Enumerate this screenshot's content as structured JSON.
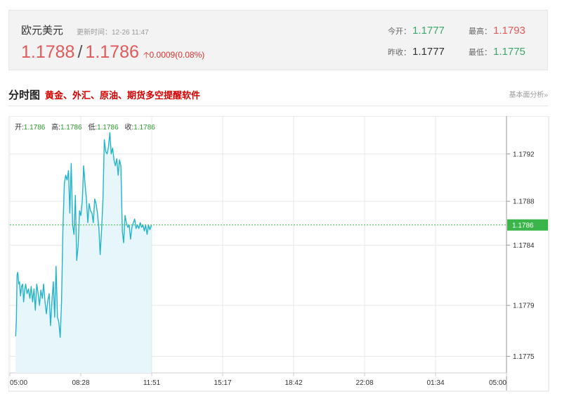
{
  "quote": {
    "pair_name": "欧元美元",
    "update_time": "更新时间：12-26 11:47",
    "bid": "1.1788",
    "ask": "1.1786",
    "change": "0.0009(0.08%)",
    "stats": {
      "open_label": "今开：",
      "open_value": "1.1777",
      "high_label": "最高：",
      "high_value": "1.1793",
      "prev_close_label": "昨收：",
      "prev_close_value": "1.1777",
      "low_label": "最低：",
      "low_value": "1.1775"
    }
  },
  "section": {
    "title": "分时图",
    "promo": "黄金、外汇、原油、期货多空提醒软件",
    "fundamental_link": "基本面分析»"
  },
  "ohlc": {
    "open_label": "开:",
    "open_value": "1.1786",
    "high_label": "高:",
    "high_value": "1.1786",
    "low_label": "低:",
    "low_value": "1.1786",
    "close_label": "收:",
    "close_value": "1.1786"
  },
  "colors": {
    "line": "#23b4cc",
    "area": "#e6f6fa",
    "reference": "#3ab54a",
    "up": "#e05a5a",
    "down": "#3aa86b"
  },
  "chart_data": {
    "type": "line",
    "x_tick_labels": [
      "05:00",
      "08:28",
      "11:51",
      "15:17",
      "18:42",
      "22:08",
      "01:34",
      "05:00"
    ],
    "y_tick_labels": [
      "1.1792",
      "1.1788",
      "1.1784",
      "1.1779",
      "1.1775"
    ],
    "y_ticks": [
      1.1792,
      1.1788,
      1.17843,
      1.17792,
      1.17749
    ],
    "ylim": [
      1.17735,
      1.17952
    ],
    "current_price": 1.1786,
    "current_price_label": "1.1786",
    "grid": true,
    "series": [
      {
        "x": [
          "05:17",
          "05:19",
          "05:21",
          "05:23",
          "05:26",
          "05:28",
          "05:31",
          "05:34",
          "05:37",
          "05:40",
          "05:43",
          "05:46",
          "05:50",
          "05:54",
          "05:58",
          "06:02",
          "06:06",
          "06:10",
          "06:14",
          "06:18",
          "06:22",
          "06:26",
          "06:30",
          "06:34",
          "06:38",
          "06:42",
          "06:46",
          "06:50",
          "06:54",
          "06:58",
          "07:02",
          "07:06",
          "07:10",
          "07:14",
          "07:18",
          "07:22",
          "07:26",
          "07:30",
          "07:34",
          "07:38",
          "07:42",
          "07:46",
          "07:50",
          "07:54",
          "07:58",
          "08:02",
          "08:06",
          "08:10",
          "08:14",
          "08:18",
          "08:22",
          "08:26",
          "08:30",
          "08:34",
          "08:38",
          "08:42",
          "08:46",
          "08:50",
          "08:54",
          "08:58",
          "09:02",
          "09:06",
          "09:10",
          "09:14",
          "09:18",
          "09:22",
          "09:26",
          "09:30",
          "09:34",
          "09:38",
          "09:42",
          "09:46",
          "09:50",
          "09:54",
          "09:58",
          "10:02",
          "10:06",
          "10:10",
          "10:14",
          "10:18",
          "10:22",
          "10:26",
          "10:30",
          "10:34",
          "10:38",
          "10:42",
          "10:46",
          "10:50",
          "10:54",
          "10:58",
          "11:02",
          "11:06",
          "11:10",
          "11:14",
          "11:18",
          "11:22",
          "11:26",
          "11:30",
          "11:34",
          "11:38",
          "11:42",
          "11:46",
          "11:51"
        ],
        "values": [
          1.17766,
          1.1778,
          1.17818,
          1.1782,
          1.1781,
          1.17812,
          1.178,
          1.17808,
          1.1781,
          1.17795,
          1.17805,
          1.1781,
          1.17802,
          1.17806,
          1.17798,
          1.17808,
          1.17795,
          1.17806,
          1.17788,
          1.1781,
          1.17802,
          1.17792,
          1.17805,
          1.17798,
          1.1781,
          1.17795,
          1.17785,
          1.17796,
          1.17802,
          1.17775,
          1.17795,
          1.17812,
          1.17782,
          1.17825,
          1.17782,
          1.17778,
          1.17765,
          1.17795,
          1.17858,
          1.17895,
          1.17902,
          1.17898,
          1.17906,
          1.1787,
          1.17912,
          1.1786,
          1.17852,
          1.17885,
          1.1783,
          1.17842,
          1.17872,
          1.17868,
          1.1788,
          1.1791,
          1.17895,
          1.17882,
          1.17862,
          1.17878,
          1.17872,
          1.1787,
          1.17862,
          1.17882,
          1.17878,
          1.1787,
          1.17858,
          1.17835,
          1.17856,
          1.17882,
          1.17932,
          1.17922,
          1.1792,
          1.17926,
          1.17938,
          1.1792,
          1.17925,
          1.17915,
          1.1791,
          1.17916,
          1.17902,
          1.17915,
          1.1791,
          1.17855,
          1.17845,
          1.17868,
          1.17862,
          1.17858,
          1.1786,
          1.17848,
          1.17858,
          1.17862,
          1.17865,
          1.17857,
          1.1786,
          1.17857,
          1.17862,
          1.17858,
          1.1786,
          1.17855,
          1.1786,
          1.17852,
          1.1786,
          1.17856,
          1.1786
        ]
      }
    ]
  }
}
